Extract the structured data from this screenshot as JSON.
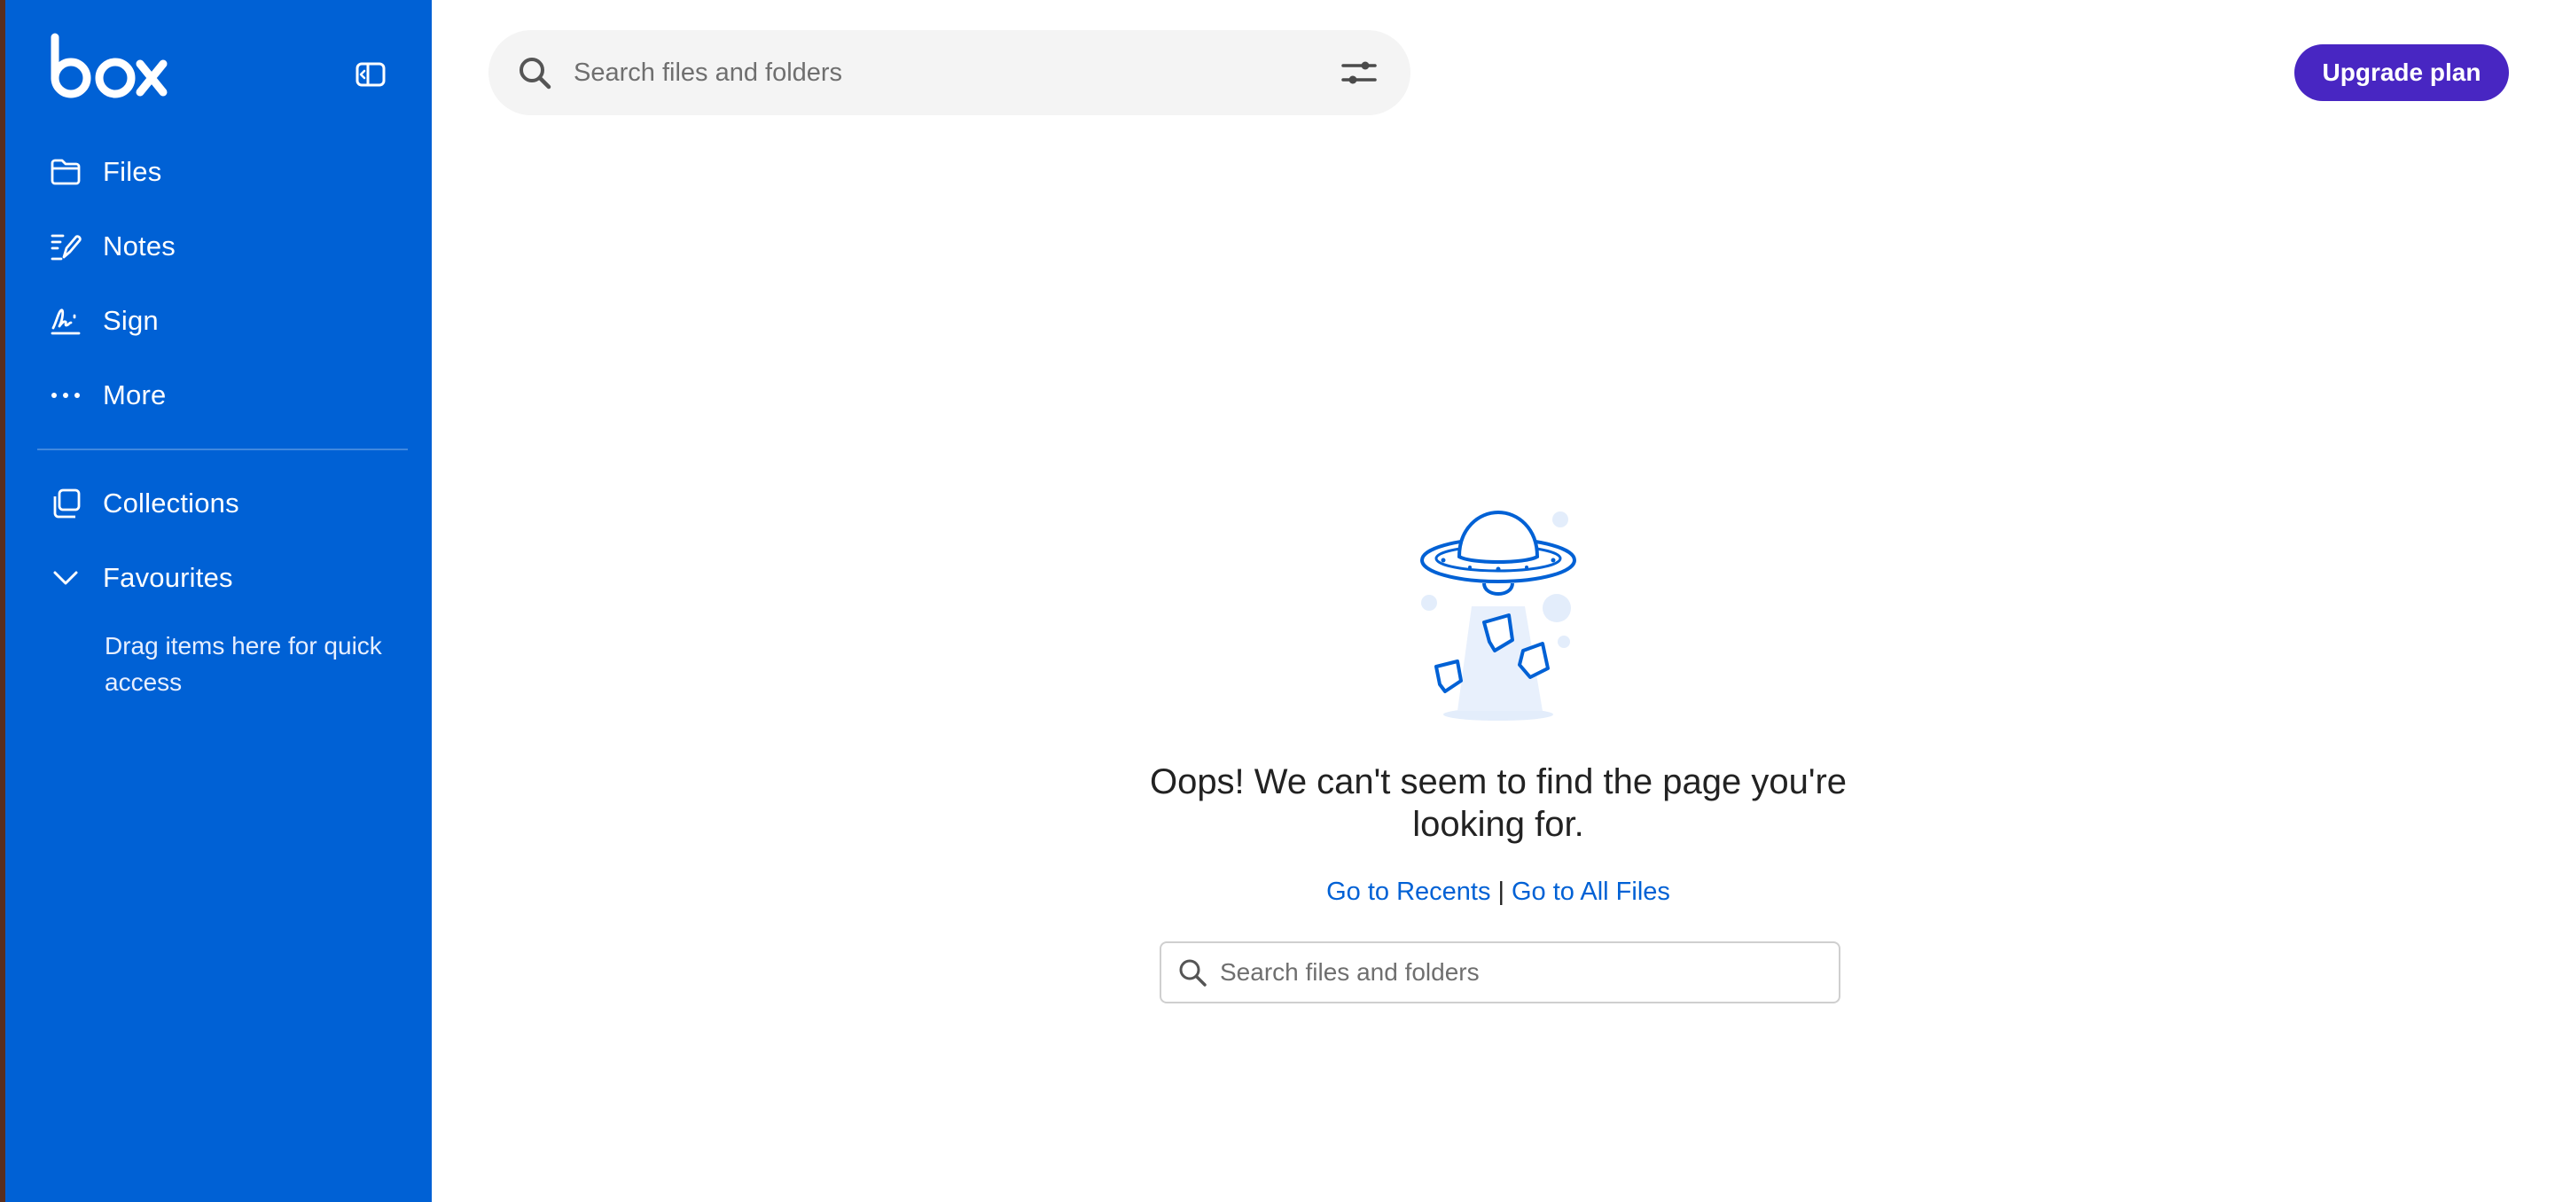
{
  "brand": {
    "logo_text": "box"
  },
  "sidebar": {
    "nav": [
      {
        "label": "Files",
        "icon": "folder-icon"
      },
      {
        "label": "Notes",
        "icon": "notes-icon"
      },
      {
        "label": "Sign",
        "icon": "sign-icon"
      },
      {
        "label": "More",
        "icon": "more-icon"
      }
    ],
    "collections": {
      "label": "Collections",
      "icon": "collections-icon"
    },
    "favourites": {
      "label": "Favourites",
      "icon": "chevron-down-icon",
      "hint": "Drag items here for quick access"
    }
  },
  "header": {
    "search_placeholder": "Search files and folders",
    "upgrade_label": "Upgrade plan"
  },
  "empty_state": {
    "message": "Oops! We can't seem to find the page you're looking for.",
    "link_recents": "Go to Recents",
    "separator": "|",
    "link_all_files": "Go to All Files",
    "search_placeholder": "Search files and folders"
  },
  "colors": {
    "sidebar_bg": "#0061d5",
    "accent_purple": "#4826c2",
    "link_blue": "#0061d5"
  }
}
